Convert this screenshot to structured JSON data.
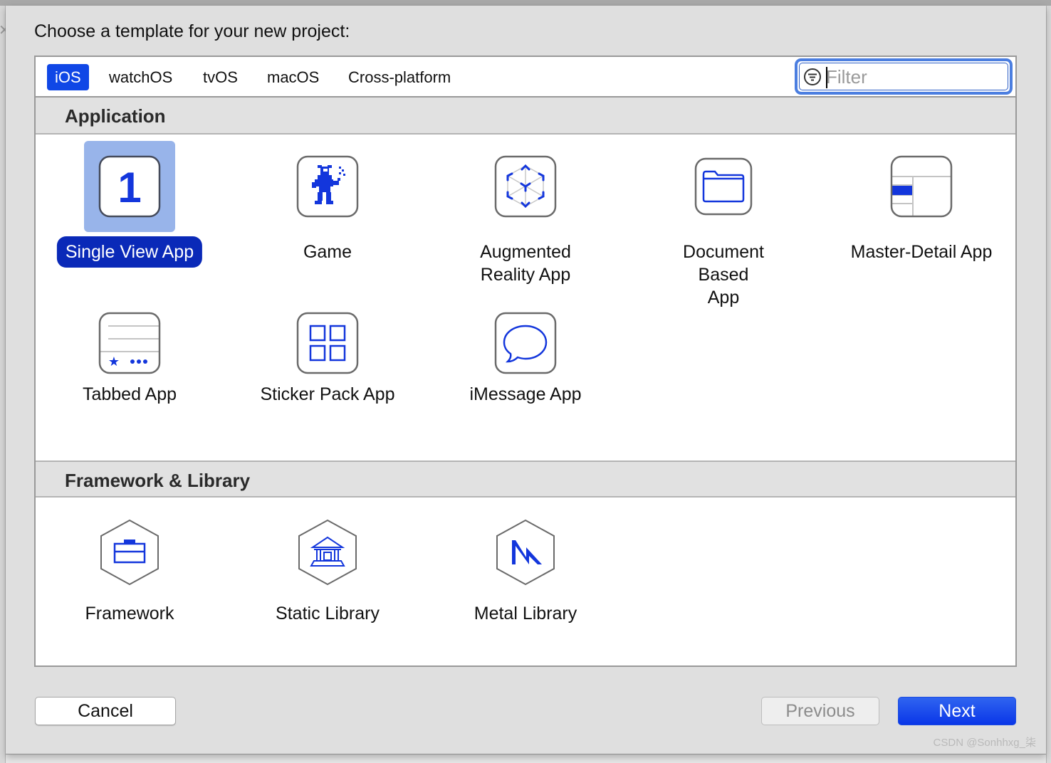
{
  "dialog": {
    "title": "Choose a template for your new project:"
  },
  "tabs": [
    {
      "label": "iOS",
      "active": true
    },
    {
      "label": "watchOS",
      "active": false
    },
    {
      "label": "tvOS",
      "active": false
    },
    {
      "label": "macOS",
      "active": false
    },
    {
      "label": "Cross-platform",
      "active": false
    }
  ],
  "filter": {
    "placeholder": "Filter",
    "value": "",
    "icon": "filter-icon"
  },
  "sections": [
    {
      "title": "Application",
      "templates": [
        {
          "label": "Single View App",
          "icon": "single-view-app-icon",
          "selected": true
        },
        {
          "label": "Game",
          "icon": "game-icon",
          "selected": false
        },
        {
          "label": "Augmented\nReality App",
          "icon": "augmented-reality-icon",
          "selected": false
        },
        {
          "label": "Document\nBased App",
          "icon": "document-folder-icon",
          "selected": false
        },
        {
          "label": "Master-Detail App",
          "icon": "master-detail-icon",
          "selected": false
        },
        {
          "label": "Tabbed App",
          "icon": "tabbed-app-icon",
          "selected": false
        },
        {
          "label": "Sticker Pack App",
          "icon": "sticker-pack-icon",
          "selected": false
        },
        {
          "label": "iMessage App",
          "icon": "imessage-bubble-icon",
          "selected": false
        }
      ]
    },
    {
      "title": "Framework & Library",
      "templates": [
        {
          "label": "Framework",
          "icon": "framework-toolbox-icon",
          "selected": false
        },
        {
          "label": "Static Library",
          "icon": "static-library-building-icon",
          "selected": false
        },
        {
          "label": "Metal Library",
          "icon": "metal-library-icon",
          "selected": false
        }
      ]
    }
  ],
  "buttons": {
    "cancel": "Cancel",
    "previous": "Previous",
    "next": "Next"
  },
  "colors": {
    "accent": "#1047e6",
    "selection_label_bg": "#0a29b8",
    "selection_icon_bg": "#98b4ea",
    "icon_blue": "#1336dc"
  },
  "watermark": "CSDN @Sonhhxg_柒"
}
